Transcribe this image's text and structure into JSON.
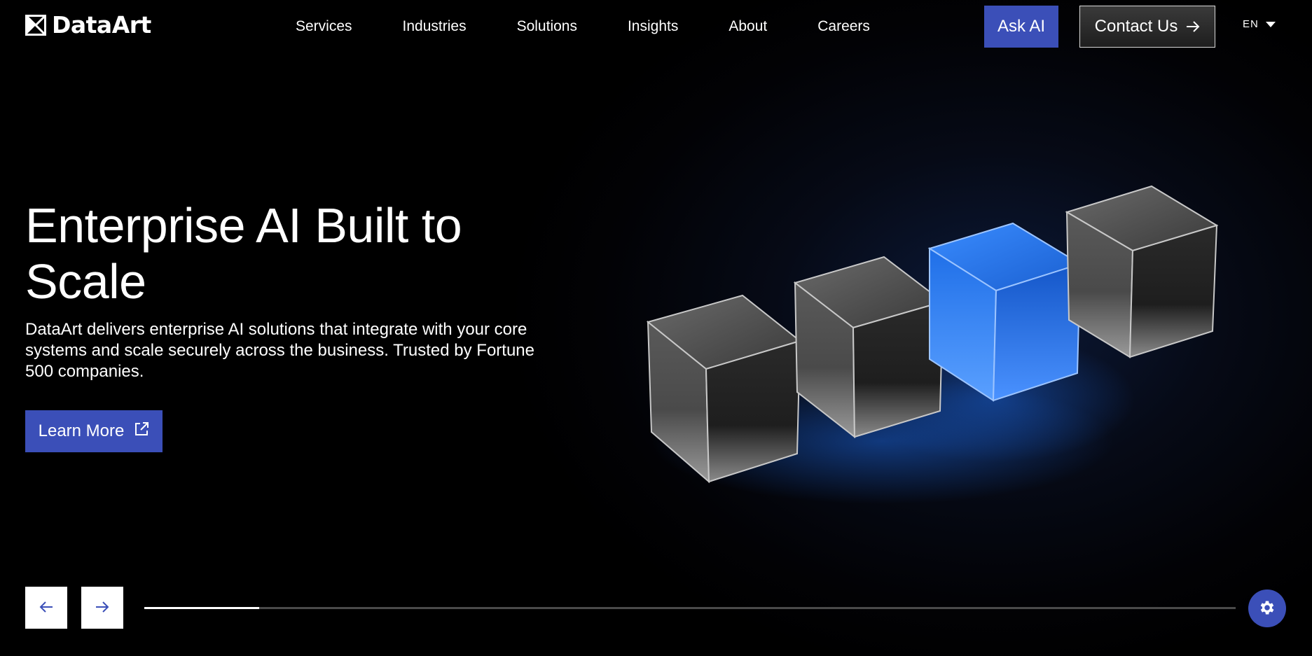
{
  "header": {
    "logo_text": "DataArt",
    "nav": [
      {
        "label": "Services"
      },
      {
        "label": "Industries"
      },
      {
        "label": "Solutions"
      },
      {
        "label": "Insights"
      },
      {
        "label": "About"
      },
      {
        "label": "Careers"
      }
    ],
    "ask_ai_label": "Ask AI",
    "contact_label": "Contact Us",
    "language": "EN"
  },
  "hero": {
    "title": "Enterprise AI Built to Scale",
    "description": "DataArt delivers enterprise AI solutions that integrate with your core systems and scale securely across the business. Trusted by Fortune 500 companies.",
    "cta_label": "Learn More"
  },
  "carousel": {
    "progress_fraction": 0.105
  },
  "colors": {
    "accent": "#3b4fb8",
    "background": "#000000",
    "highlight_cube": "#1a6fe0"
  },
  "icons": {
    "logo": "dataart-logo-icon",
    "contact_arrow": "arrow-right-icon",
    "language_caret": "caret-down-icon",
    "learn_more": "external-link-icon",
    "prev": "arrow-left-icon",
    "next": "arrow-right-icon",
    "settings": "gear-icon"
  }
}
